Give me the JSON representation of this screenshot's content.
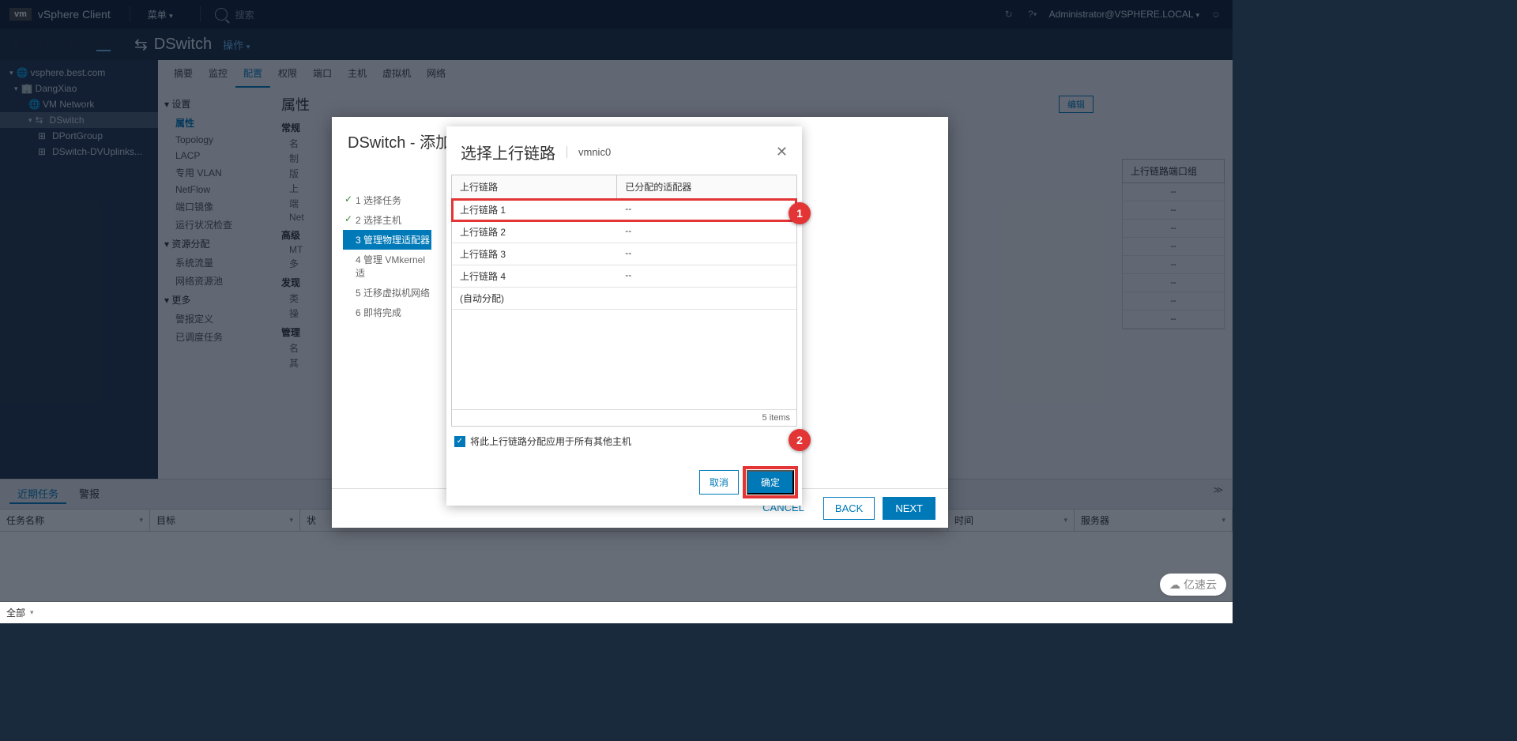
{
  "header": {
    "logo": "vm",
    "product": "vSphere Client",
    "menu": "菜单",
    "search_placeholder": "搜索",
    "user": "Administrator@VSPHERE.LOCAL"
  },
  "tree": {
    "root": "vsphere.best.com",
    "dc": "DangXiao",
    "vm_network": "VM Network",
    "dswitch": "DSwitch",
    "dportgroup": "DPortGroup",
    "uplinks": "DSwitch-DVUplinks..."
  },
  "entity": {
    "title": "DSwitch",
    "actions": "操作"
  },
  "tabs": {
    "summary": "摘要",
    "monitor": "监控",
    "configure": "配置",
    "permissions": "权限",
    "ports": "端口",
    "hosts": "主机",
    "vms": "虚拟机",
    "networks": "网络"
  },
  "side": {
    "settings": "设置",
    "properties": "属性",
    "topology": "Topology",
    "lacp": "LACP",
    "pvlan": "专用 VLAN",
    "netflow": "NetFlow",
    "mirror": "端口镜像",
    "health": "运行状况检查",
    "resource": "资源分配",
    "sysflow": "系统流量",
    "netpool": "网络资源池",
    "more": "更多",
    "alarm": "警报定义",
    "sched": "已调度任务"
  },
  "props": {
    "title": "属性",
    "edit": "编辑",
    "general": "常规",
    "name": "名",
    "vendor": "制",
    "version": "版",
    "up": "上",
    "port": "端",
    "net": "Net",
    "advanced": "高级",
    "mtu": "MT",
    "multi": "多",
    "discovery": "发现",
    "type": "类",
    "oper": "操",
    "admin": "管理",
    "nm": "名",
    "other": "其"
  },
  "wizard": {
    "title": "DSwitch - 添加",
    "steps": {
      "s1": "1 选择任务",
      "s2": "2 选择主机",
      "s3": "3 管理物理适配器",
      "s4": "4 管理 VMkernel 适",
      "s5": "5 迁移虚拟机网络",
      "s6": "6 即将完成"
    },
    "cancel": "CANCEL",
    "back": "BACK",
    "next": "NEXT"
  },
  "inner_modal": {
    "title": "选择上行链路",
    "subtitle": "vmnic0",
    "th1": "上行链路",
    "th2": "已分配的适配器",
    "rows": [
      {
        "name": "上行链路 1",
        "assigned": "--"
      },
      {
        "name": "上行链路 2",
        "assigned": "--"
      },
      {
        "name": "上行链路 3",
        "assigned": "--"
      },
      {
        "name": "上行链路 4",
        "assigned": "--"
      },
      {
        "name": "(自动分配)",
        "assigned": ""
      }
    ],
    "items": "5 items",
    "checkbox_label": "将此上行链路分配应用于所有其他主机",
    "cancel": "取消",
    "ok": "确定"
  },
  "bk_right": {
    "col": "上行链路端口组",
    "dash": "--"
  },
  "tasks": {
    "recent": "近期任务",
    "alarms": "警报",
    "cols": {
      "name": "任务名称",
      "target": "目标",
      "status": "状",
      "start": "时间",
      "server": "服务器"
    },
    "footer": "全部"
  },
  "callouts": {
    "one": "1",
    "two": "2"
  },
  "watermark": "亿速云"
}
